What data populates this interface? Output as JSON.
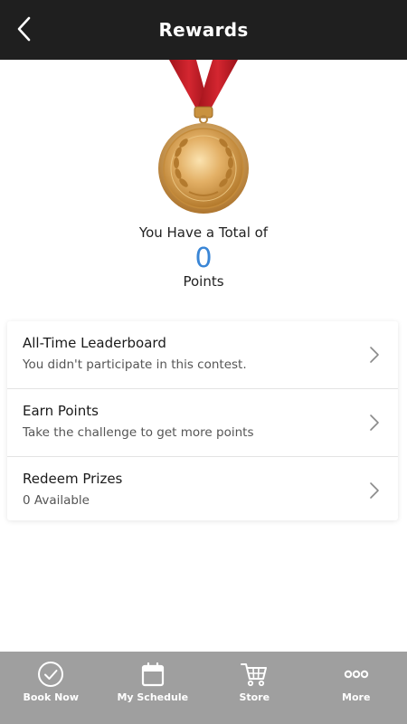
{
  "header": {
    "title": "Rewards",
    "back_icon": "chevron-left-icon"
  },
  "medal": {
    "icon": "gold-medal-icon",
    "ribbon_color": "#c8202a",
    "gold_color": "#d9a247"
  },
  "summary": {
    "line1": "You Have a Total of",
    "points_value": "0",
    "points_label": "Points",
    "value_color": "#3a86d6"
  },
  "list": {
    "items": [
      {
        "title": "All-Time Leaderboard",
        "subtitle": "You didn't participate in this contest."
      },
      {
        "title": "Earn Points",
        "subtitle": "Take the challenge to get more points"
      },
      {
        "title": "Redeem Prizes",
        "subtitle": "0 Available"
      }
    ]
  },
  "bottom_nav": {
    "items": [
      {
        "label": "Book Now",
        "icon": "check-circle-icon"
      },
      {
        "label": "My Schedule",
        "icon": "calendar-icon"
      },
      {
        "label": "Store",
        "icon": "cart-icon"
      },
      {
        "label": "More",
        "icon": "more-dots-icon"
      }
    ],
    "background": "#9f9f9f"
  }
}
